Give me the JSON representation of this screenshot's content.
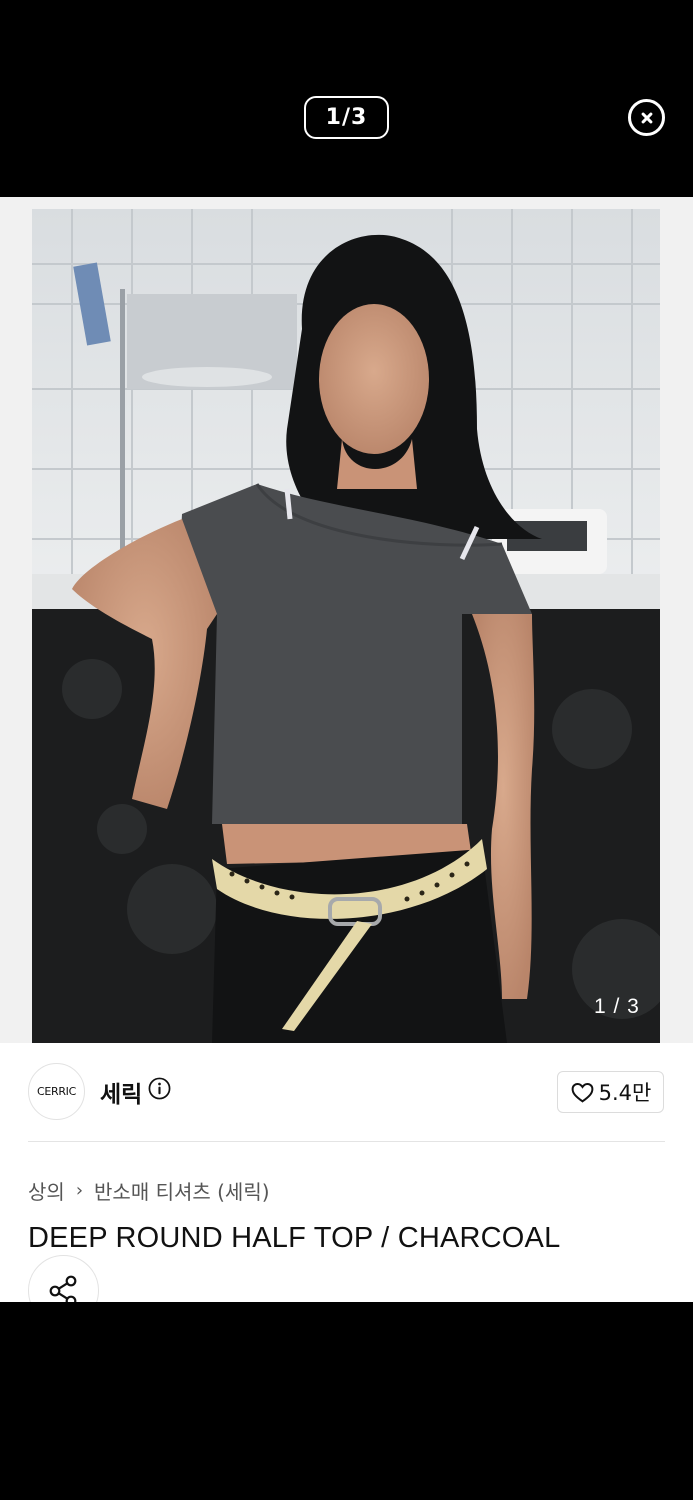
{
  "viewer": {
    "counter": "1/3",
    "close_icon": "close-circle-icon"
  },
  "gallery": {
    "image_counter": "1 / 3",
    "expand_icon": "expand-icon"
  },
  "brand": {
    "logo_text": "CERRIC",
    "name": "세릭",
    "info_icon": "info-icon"
  },
  "like": {
    "icon": "heart-icon",
    "count": "5.4만"
  },
  "breadcrumb": {
    "level1": "상의",
    "separator_icon": "chevron-right-icon",
    "level2": "반소매 티셔츠 (세릭)"
  },
  "product": {
    "title": "DEEP ROUND HALF TOP / CHARCOAL"
  },
  "share": {
    "icon": "share-icon"
  },
  "colors": {
    "top_bar": "#000000",
    "text": "#111111",
    "muted": "#555555"
  }
}
